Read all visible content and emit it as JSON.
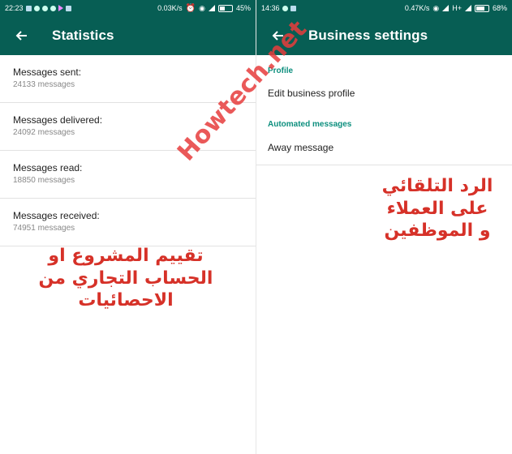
{
  "left": {
    "status": {
      "time": "22:23",
      "speed": "0.03K/s",
      "battery": "45%"
    },
    "title": "Statistics",
    "items": [
      {
        "label": "Messages sent:",
        "value": "24133 messages"
      },
      {
        "label": "Messages delivered:",
        "value": "24092 messages"
      },
      {
        "label": "Messages read:",
        "value": "18850 messages"
      },
      {
        "label": "Messages received:",
        "value": "74951 messages"
      }
    ],
    "overlay_lines": [
      "تقييم المشروع او",
      "الحساب التجاري من",
      "الاحصائيات"
    ]
  },
  "right": {
    "status": {
      "time": "14:36",
      "speed": "0.47K/s",
      "network": "H+",
      "battery": "68%"
    },
    "title": "Business settings",
    "section_profile": "Profile",
    "edit_profile": "Edit business profile",
    "section_automated": "Automated messages",
    "away_message": "Away message",
    "overlay_lines": [
      "الرد التلقائي",
      "على العملاء",
      "و الموظفين"
    ]
  },
  "watermark": "Howtech.net",
  "colors": {
    "appbar": "#075e54",
    "accent": "#0d8f7e",
    "overlay_text": "#d63128"
  }
}
